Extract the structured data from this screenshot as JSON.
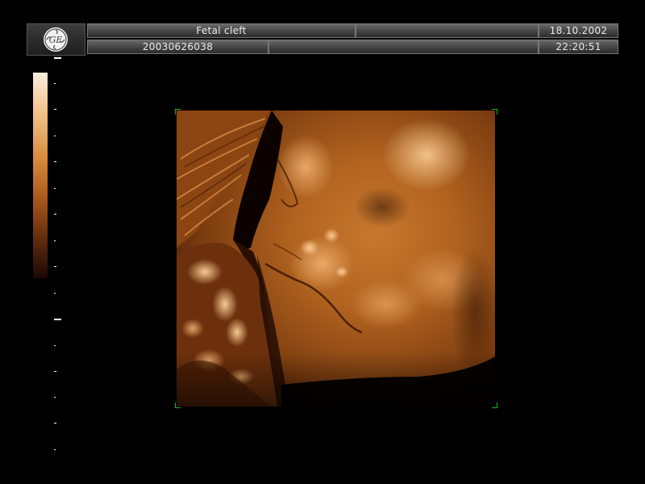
{
  "header": {
    "logo_icon": "ge-logo",
    "title": "Fetal cleft",
    "title_extra": "",
    "date": "18.10.2002",
    "patient_id": "20030626038",
    "info_extra": "",
    "time": "22:20:51"
  },
  "colors": {
    "background": "#000000",
    "accent": "#c8782e",
    "marker": "#1fb81f"
  },
  "scale_icon": "grayscale-map-bar",
  "image_icon": "3d-ultrasound-render"
}
